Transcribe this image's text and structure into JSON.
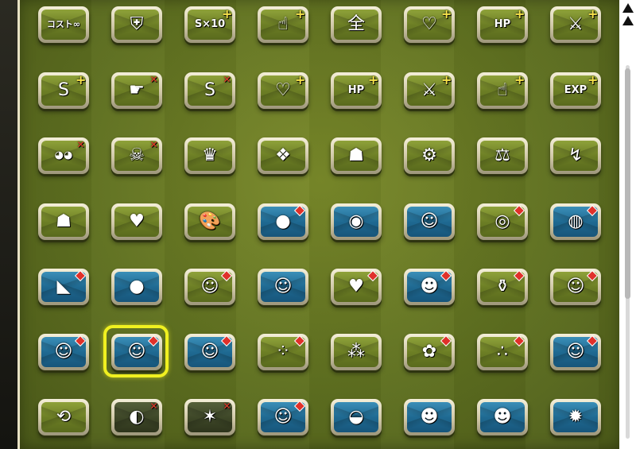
{
  "grid": {
    "rows": [
      [
        {
          "icon": "cost-infinity-icon",
          "text": "コスト∞",
          "size": "small",
          "bg": "green",
          "mark": "none"
        },
        {
          "icon": "rainbow-shield-icon",
          "text": "⛨",
          "bg": "green",
          "mark": "none"
        },
        {
          "icon": "speed-x10-icon",
          "text": "S×10",
          "size": "med",
          "bg": "green",
          "mark": "plus"
        },
        {
          "icon": "finger-tap-icon",
          "text": "☝",
          "bg": "green",
          "mark": "plus"
        },
        {
          "icon": "all-shield-icon",
          "text": "全",
          "bg": "green",
          "mark": "none"
        },
        {
          "icon": "heart-icon",
          "text": "♡",
          "bg": "green",
          "mark": "plus"
        },
        {
          "icon": "hp-heart-icon",
          "text": "HP",
          "size": "med",
          "bg": "green",
          "mark": "plus"
        },
        {
          "icon": "sword-icon",
          "text": "⚔",
          "bg": "green",
          "mark": "plus"
        }
      ],
      [
        {
          "icon": "speed-icon",
          "text": "S",
          "bg": "green",
          "mark": "plus"
        },
        {
          "icon": "hand-swipe-icon",
          "text": "☛",
          "bg": "green",
          "mark": "cross"
        },
        {
          "icon": "speed-down-icon",
          "text": "S",
          "bg": "green",
          "mark": "cross"
        },
        {
          "icon": "heart-up-icon",
          "text": "♡",
          "bg": "green",
          "mark": "plus"
        },
        {
          "icon": "hp-heart-up-icon",
          "text": "HP",
          "size": "med",
          "bg": "green",
          "mark": "plus"
        },
        {
          "icon": "sword-up-icon",
          "text": "⚔",
          "bg": "green",
          "mark": "plus"
        },
        {
          "icon": "finger-up-icon",
          "text": "☝",
          "bg": "green",
          "mark": "plus"
        },
        {
          "icon": "exp-up-icon",
          "text": "EXP",
          "size": "med",
          "bg": "green",
          "mark": "plus"
        }
      ],
      [
        {
          "icon": "sunglasses-icon",
          "text": "◕◕",
          "size": "med",
          "bg": "green",
          "mark": "cross"
        },
        {
          "icon": "skull-icon",
          "text": "☠",
          "bg": "green",
          "mark": "cross"
        },
        {
          "icon": "crown-shield-icon",
          "text": "♛",
          "bg": "green",
          "mark": "none"
        },
        {
          "icon": "dragon-icon",
          "text": "❖",
          "bg": "green",
          "mark": "none"
        },
        {
          "icon": "demon-mask-icon",
          "text": "☗",
          "bg": "green",
          "mark": "none"
        },
        {
          "icon": "gear-shield-icon",
          "text": "⚙",
          "bg": "green",
          "mark": "none"
        },
        {
          "icon": "balance-scale-icon",
          "text": "⚖",
          "bg": "green",
          "mark": "none"
        },
        {
          "icon": "claw-icon",
          "text": "↯",
          "bg": "green",
          "mark": "none"
        }
      ],
      [
        {
          "icon": "guard-shield-icon",
          "text": "☗",
          "bg": "green",
          "mark": "none"
        },
        {
          "icon": "heart-shield-icon",
          "text": "♥",
          "bg": "green",
          "mark": "none"
        },
        {
          "icon": "paint-palette-icon",
          "text": "🎨",
          "bg": "green",
          "mark": "none"
        },
        {
          "icon": "green-slime-icon",
          "text": "●",
          "bg": "blue",
          "mark": "diamond"
        },
        {
          "icon": "blue-slime-icon",
          "text": "◉",
          "bg": "blue",
          "mark": "none"
        },
        {
          "icon": "character-blonde-icon",
          "text": "☺",
          "bg": "blue",
          "mark": "none"
        },
        {
          "icon": "ring-icon",
          "text": "◎",
          "bg": "green",
          "mark": "diamond"
        },
        {
          "icon": "racket-icon",
          "text": "◍",
          "bg": "blue",
          "mark": "diamond"
        }
      ],
      [
        {
          "icon": "dinosaur-icon",
          "text": "◣",
          "bg": "blue",
          "mark": "diamond"
        },
        {
          "icon": "mouse-ears-icon",
          "text": "●",
          "bg": "blue",
          "mark": "none"
        },
        {
          "icon": "character-green-hair-icon",
          "text": "☺",
          "bg": "green",
          "mark": "diamond"
        },
        {
          "icon": "character-white-hair-icon",
          "text": "☺",
          "bg": "blue",
          "mark": "none"
        },
        {
          "icon": "heart-card-icon",
          "text": "♥",
          "bg": "green",
          "mark": "diamond"
        },
        {
          "icon": "character-dark-hair-icon",
          "text": "☻",
          "bg": "blue",
          "mark": "diamond"
        },
        {
          "icon": "potion-icon",
          "text": "⚱",
          "bg": "green",
          "mark": "diamond"
        },
        {
          "icon": "character-silver-hair-icon",
          "text": "☺",
          "bg": "green",
          "mark": "diamond"
        }
      ],
      [
        {
          "icon": "character-headband-icon",
          "text": "☺",
          "bg": "blue",
          "mark": "diamond"
        },
        {
          "icon": "character-black-hair-icon",
          "text": "☺",
          "bg": "blue",
          "mark": "diamond"
        },
        {
          "icon": "character-white-cloak-icon",
          "text": "☺",
          "bg": "blue",
          "mark": "diamond"
        },
        {
          "icon": "orb-grid-icon",
          "text": "⁘",
          "bg": "green",
          "mark": "diamond"
        },
        {
          "icon": "orb-stack-icon",
          "text": "⁂",
          "bg": "green",
          "mark": "none"
        },
        {
          "icon": "pink-flower-icon",
          "text": "✿",
          "bg": "green",
          "mark": "diamond"
        },
        {
          "icon": "orb-row-icon",
          "text": "∴",
          "bg": "green",
          "mark": "diamond"
        },
        {
          "icon": "character-silver-spiky-icon",
          "text": "☺",
          "bg": "blue",
          "mark": "diamond"
        }
      ],
      [
        {
          "icon": "cycle-arrows-icon",
          "text": "⟲",
          "bg": "green",
          "mark": "none"
        },
        {
          "icon": "dark-ring-icon",
          "text": "◐",
          "bg": "dark",
          "mark": "cross"
        },
        {
          "icon": "dark-spark-icon",
          "text": "✶",
          "bg": "dark",
          "mark": "cross"
        },
        {
          "icon": "character-green-spiky-icon",
          "text": "☺",
          "bg": "blue",
          "mark": "diamond"
        },
        {
          "icon": "silver-mask-icon",
          "text": "◒",
          "bg": "blue",
          "mark": "none"
        },
        {
          "icon": "character-dark-long-hair-icon",
          "text": "☻",
          "bg": "blue",
          "mark": "none"
        },
        {
          "icon": "character-masked-hero-icon",
          "text": "☻",
          "bg": "blue",
          "mark": "none"
        },
        {
          "icon": "character-red-beast-icon",
          "text": "✹",
          "bg": "blue",
          "mark": "none"
        }
      ]
    ],
    "selected": {
      "row": 5,
      "col": 1
    }
  },
  "scrollbar": {
    "arrow_icon": "scroll-up-top-icon"
  }
}
